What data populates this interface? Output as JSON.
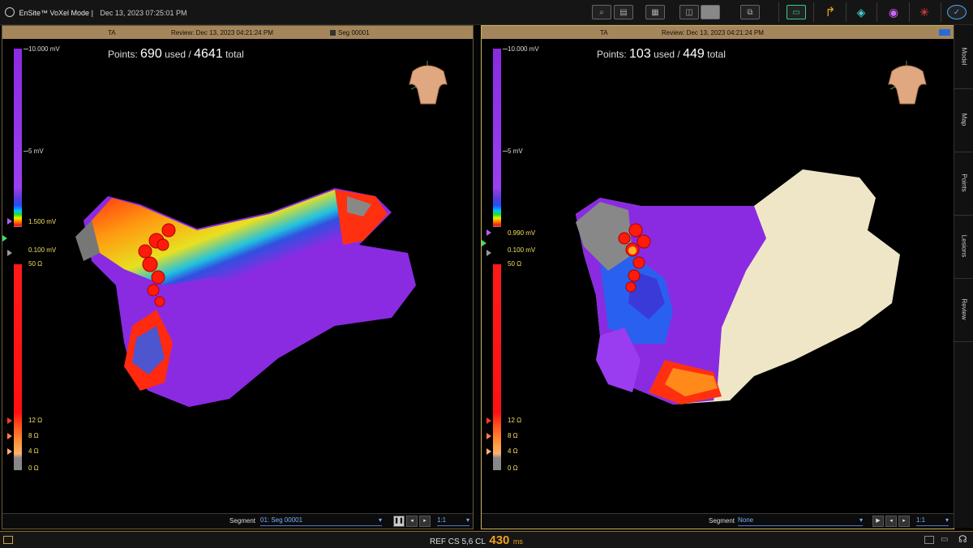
{
  "app": {
    "brand": "EnSite™ VoXel Mode |",
    "datetime": "Dec 13, 2023 07:25:01 PM"
  },
  "toolbar": {
    "icons": [
      "search-icon",
      "display-icon",
      "layout-icon",
      "dual-view-icon",
      "single-view-icon",
      "screen-icon",
      "monitor-icon",
      "catheter-icon",
      "mask-icon",
      "mapping-icon",
      "ablation-icon",
      "navigation-icon"
    ]
  },
  "left_panel": {
    "header_left": "TA",
    "header_center": "Review: Dec 13, 2023 04:21:24 PM",
    "header_right": "Seg 00001",
    "points_label": "Points:",
    "points_used": "690",
    "used_label": "used /",
    "points_total": "4641",
    "total_label": "total",
    "voltage_scale": {
      "top": "10.000 mV",
      "mid": "5 mV",
      "upper": "1.500 mV",
      "lower": "0.100 mV"
    },
    "impedance_scale": {
      "top": "50 Ω",
      "a": "12 Ω",
      "b": "8 Ω",
      "c": "4 Ω",
      "d": "0 Ω"
    },
    "footer": {
      "segment_label": "Segment",
      "segment_value": "01: Seg 00001",
      "ratio": "1:1"
    }
  },
  "right_panel": {
    "header_left": "TA",
    "header_center": "Review: Dec 13, 2023 04:21:24 PM",
    "points_label": "Points:",
    "points_used": "103",
    "used_label": "used /",
    "points_total": "449",
    "total_label": "total",
    "voltage_scale": {
      "top": "10.000 mV",
      "mid": "5 mV",
      "upper": "0.990 mV",
      "lower": "0.100 mV"
    },
    "impedance_scale": {
      "top": "50 Ω",
      "a": "12 Ω",
      "b": "8 Ω",
      "c": "4 Ω",
      "d": "0 Ω"
    },
    "footer": {
      "segment_label": "Segment",
      "segment_value": "None",
      "ratio": "1:1"
    }
  },
  "side_tabs": [
    "Model",
    "Map",
    "Points",
    "Lesions",
    "Review"
  ],
  "status": {
    "ref_text": "REF CS 5,6 CL",
    "cl_value": "430",
    "cl_unit": "ms"
  },
  "colors": {
    "accent": "#a5865a",
    "active_border": "#c8b060",
    "cl_value": "#f0a020"
  }
}
